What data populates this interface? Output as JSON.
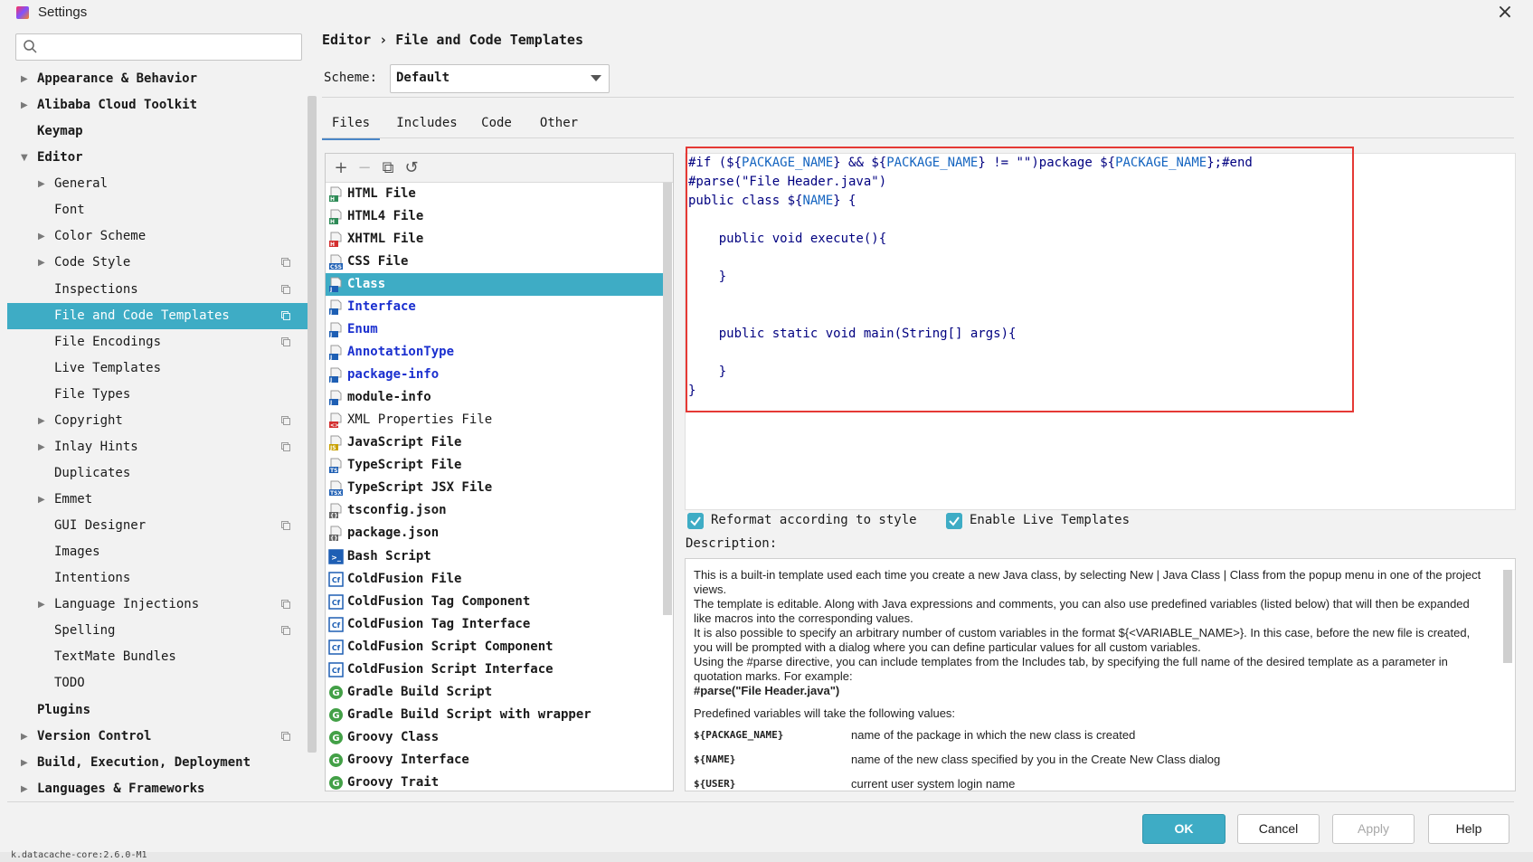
{
  "window": {
    "title": "Settings"
  },
  "search": {
    "placeholder": ""
  },
  "tree": [
    {
      "label": "Appearance & Behavior",
      "level": 0,
      "arrow": "right",
      "bold": true,
      "copy": false
    },
    {
      "label": "Alibaba Cloud Toolkit",
      "level": 0,
      "arrow": "right",
      "bold": true,
      "copy": false
    },
    {
      "label": "Keymap",
      "level": 0,
      "arrow": "",
      "bold": true,
      "copy": false
    },
    {
      "label": "Editor",
      "level": 0,
      "arrow": "down",
      "bold": true,
      "copy": false
    },
    {
      "label": "General",
      "level": 1,
      "arrow": "right",
      "bold": false,
      "copy": false
    },
    {
      "label": "Font",
      "level": 1,
      "arrow": "",
      "bold": false,
      "copy": false
    },
    {
      "label": "Color Scheme",
      "level": 1,
      "arrow": "right",
      "bold": false,
      "copy": false
    },
    {
      "label": "Code Style",
      "level": 1,
      "arrow": "right",
      "bold": false,
      "copy": true
    },
    {
      "label": "Inspections",
      "level": 1,
      "arrow": "",
      "bold": false,
      "copy": true
    },
    {
      "label": "File and Code Templates",
      "level": 1,
      "arrow": "",
      "bold": false,
      "copy": true,
      "selected": true
    },
    {
      "label": "File Encodings",
      "level": 1,
      "arrow": "",
      "bold": false,
      "copy": true
    },
    {
      "label": "Live Templates",
      "level": 1,
      "arrow": "",
      "bold": false,
      "copy": false
    },
    {
      "label": "File Types",
      "level": 1,
      "arrow": "",
      "bold": false,
      "copy": false
    },
    {
      "label": "Copyright",
      "level": 1,
      "arrow": "right",
      "bold": false,
      "copy": true
    },
    {
      "label": "Inlay Hints",
      "level": 1,
      "arrow": "right",
      "bold": false,
      "copy": true
    },
    {
      "label": "Duplicates",
      "level": 1,
      "arrow": "",
      "bold": false,
      "copy": false
    },
    {
      "label": "Emmet",
      "level": 1,
      "arrow": "right",
      "bold": false,
      "copy": false
    },
    {
      "label": "GUI Designer",
      "level": 1,
      "arrow": "",
      "bold": false,
      "copy": true
    },
    {
      "label": "Images",
      "level": 1,
      "arrow": "",
      "bold": false,
      "copy": false
    },
    {
      "label": "Intentions",
      "level": 1,
      "arrow": "",
      "bold": false,
      "copy": false
    },
    {
      "label": "Language Injections",
      "level": 1,
      "arrow": "right",
      "bold": false,
      "copy": true
    },
    {
      "label": "Spelling",
      "level": 1,
      "arrow": "",
      "bold": false,
      "copy": true
    },
    {
      "label": "TextMate Bundles",
      "level": 1,
      "arrow": "",
      "bold": false,
      "copy": false
    },
    {
      "label": "TODO",
      "level": 1,
      "arrow": "",
      "bold": false,
      "copy": false
    },
    {
      "label": "Plugins",
      "level": 0,
      "arrow": "",
      "bold": true,
      "copy": false
    },
    {
      "label": "Version Control",
      "level": 0,
      "arrow": "right",
      "bold": true,
      "copy": true
    },
    {
      "label": "Build, Execution, Deployment",
      "level": 0,
      "arrow": "right",
      "bold": true,
      "copy": false
    },
    {
      "label": "Languages & Frameworks",
      "level": 0,
      "arrow": "right",
      "bold": true,
      "copy": false
    }
  ],
  "breadcrumb": {
    "parent": "Editor",
    "separator": "›",
    "current": "File and Code Templates"
  },
  "scheme": {
    "label": "Scheme:",
    "value": "Default"
  },
  "tabs": [
    "Files",
    "Includes",
    "Code",
    "Other"
  ],
  "active_tab": "Files",
  "toolbar": {
    "add": "+",
    "remove": "−",
    "copy": "⧉",
    "reset": "↺"
  },
  "templates": [
    {
      "label": "HTML File",
      "icon": "html",
      "color": "#2e8b57"
    },
    {
      "label": "HTML4 File",
      "icon": "html",
      "color": "#2e8b57"
    },
    {
      "label": "XHTML File",
      "icon": "xhtml",
      "color": "#d32f2f"
    },
    {
      "label": "CSS File",
      "icon": "css",
      "color": "#1e5fb4"
    },
    {
      "label": "Class",
      "icon": "java",
      "color": "#1e5fb4",
      "selected": true
    },
    {
      "label": "Interface",
      "icon": "java",
      "color": "#1e5fb4",
      "style": "blue"
    },
    {
      "label": "Enum",
      "icon": "java",
      "color": "#1e5fb4",
      "style": "blue"
    },
    {
      "label": "AnnotationType",
      "icon": "java",
      "color": "#1e5fb4",
      "style": "blue"
    },
    {
      "label": "package-info",
      "icon": "java",
      "color": "#1e5fb4",
      "style": "blue"
    },
    {
      "label": "module-info",
      "icon": "java",
      "color": "#1e5fb4"
    },
    {
      "label": "XML Properties File",
      "icon": "xml",
      "color": "#d32f2f",
      "style": "normal"
    },
    {
      "label": "JavaScript File",
      "icon": "js",
      "color": "#c9a100"
    },
    {
      "label": "TypeScript File",
      "icon": "ts",
      "color": "#1e5fb4"
    },
    {
      "label": "TypeScript JSX File",
      "icon": "tsx",
      "color": "#1e5fb4"
    },
    {
      "label": "tsconfig.json",
      "icon": "json",
      "color": "#666666"
    },
    {
      "label": "package.json",
      "icon": "json",
      "color": "#666666"
    },
    {
      "label": "Bash Script",
      "icon": "bash",
      "color": "#1e5fb4"
    },
    {
      "label": "ColdFusion File",
      "icon": "cf",
      "color": "#1e5fb4"
    },
    {
      "label": "ColdFusion Tag Component",
      "icon": "cf",
      "color": "#1e5fb4"
    },
    {
      "label": "ColdFusion Tag Interface",
      "icon": "cf",
      "color": "#1e5fb4"
    },
    {
      "label": "ColdFusion Script Component",
      "icon": "cf",
      "color": "#1e5fb4"
    },
    {
      "label": "ColdFusion Script Interface",
      "icon": "cf",
      "color": "#1e5fb4"
    },
    {
      "label": "Gradle Build Script",
      "icon": "gradle",
      "color": "#43a047"
    },
    {
      "label": "Gradle Build Script with wrapper",
      "icon": "gradle",
      "color": "#43a047"
    },
    {
      "label": "Groovy Class",
      "icon": "groovy",
      "color": "#43a047"
    },
    {
      "label": "Groovy Interface",
      "icon": "groovy",
      "color": "#43a047"
    },
    {
      "label": "Groovy Trait",
      "icon": "groovy",
      "color": "#43a047"
    }
  ],
  "code_lines": [
    "#if (${PACKAGE_NAME} && ${PACKAGE_NAME} != \"\")package ${PACKAGE_NAME};#end",
    "#parse(\"File Header.java\")",
    "public class ${NAME} {",
    "",
    "    public void execute(){",
    "",
    "    }",
    "",
    "",
    "    public static void main(String[] args){",
    "",
    "    }",
    "}"
  ],
  "options": {
    "reformat": {
      "label": "Reformat according to style",
      "checked": true
    },
    "live_templates": {
      "label": "Enable Live Templates",
      "checked": true
    }
  },
  "description": {
    "label": "Description:",
    "paragraphs": [
      "This is a built-in template used each time you create a new Java class, by selecting New | Java Class | Class from the popup menu in one of the project views.",
      "The template is editable. Along with Java expressions and comments, you can also use predefined variables (listed below) that will then be expanded like macros into the corresponding values.",
      "It is also possible to specify an arbitrary number of custom variables in the format ${<VARIABLE_NAME>}. In this case, before the new file is created, you will be prompted with a dialog where you can define particular values for all custom variables.",
      "Using the #parse directive, you can include templates from the Includes tab, by specifying the full name of the desired template as a parameter in quotation marks. For example:"
    ],
    "example": "#parse(\"File Header.java\")",
    "predefined_intro": "Predefined variables will take the following values:",
    "variables": [
      {
        "name": "${PACKAGE_NAME}",
        "desc": "name of the package in which the new class is created"
      },
      {
        "name": "${NAME}",
        "desc": "name of the new class specified by you in the Create New Class dialog"
      },
      {
        "name": "${USER}",
        "desc": "current user system login name"
      }
    ]
  },
  "buttons": {
    "ok": "OK",
    "cancel": "Cancel",
    "apply": "Apply",
    "help": "Help"
  },
  "status_strip": "k.datacache-core:2.6.0-M1",
  "colors": {
    "accent": "#3eacc5",
    "highlight_box": "#e53935",
    "code_text": "#000080",
    "code_var": "#1565c0"
  }
}
